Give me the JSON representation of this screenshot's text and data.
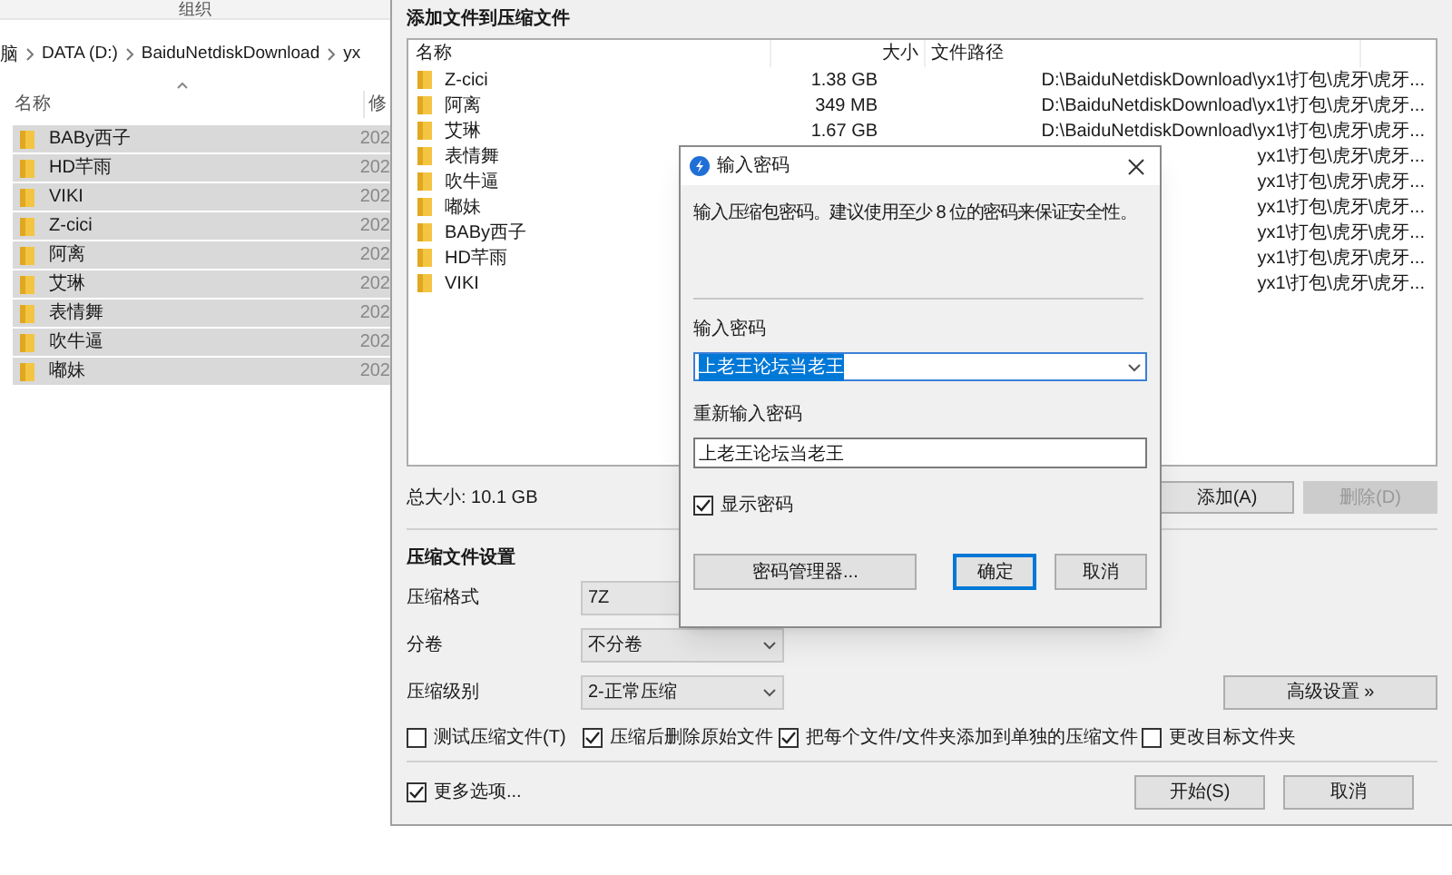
{
  "explorer": {
    "ribbon_label": "组织",
    "breadcrumb": [
      "脑",
      "DATA (D:)",
      "BaiduNetdiskDownload",
      "yx"
    ],
    "columns": [
      "名称",
      "修"
    ],
    "rows": [
      {
        "name": "BABy西子",
        "date": "202",
        "selected": true
      },
      {
        "name": "HD芊雨",
        "date": "202",
        "selected": true
      },
      {
        "name": "VIKI",
        "date": "202",
        "selected": true
      },
      {
        "name": "Z-cici",
        "date": "202",
        "selected": true
      },
      {
        "name": "阿离",
        "date": "202",
        "selected": true
      },
      {
        "name": "艾琳",
        "date": "202",
        "selected": true
      },
      {
        "name": "表情舞",
        "date": "202",
        "selected": true
      },
      {
        "name": "吹牛逼",
        "date": "202",
        "selected": true
      },
      {
        "name": "嘟妹",
        "date": "202",
        "selected": true
      }
    ]
  },
  "archive": {
    "title": "添加文件到压缩文件",
    "columns": [
      "名称",
      "大小",
      "文件路径"
    ],
    "files": [
      {
        "name": "Z-cici",
        "size": "1.38 GB",
        "path": "D:\\BaiduNetdiskDownload\\yx1\\打包\\虎牙\\虎牙..."
      },
      {
        "name": "阿离",
        "size": "349 MB",
        "path": "D:\\BaiduNetdiskDownload\\yx1\\打包\\虎牙\\虎牙..."
      },
      {
        "name": "艾琳",
        "size": "1.67 GB",
        "path": "D:\\BaiduNetdiskDownload\\yx1\\打包\\虎牙\\虎牙..."
      },
      {
        "name": "表情舞",
        "path": "yx1\\打包\\虎牙\\虎牙..."
      },
      {
        "name": "吹牛逼",
        "path": "yx1\\打包\\虎牙\\虎牙..."
      },
      {
        "name": "嘟妹",
        "path": "yx1\\打包\\虎牙\\虎牙..."
      },
      {
        "name": "BABy西子",
        "path": "yx1\\打包\\虎牙\\虎牙..."
      },
      {
        "name": "HD芊雨",
        "path": "yx1\\打包\\虎牙\\虎牙..."
      },
      {
        "name": "VIKI",
        "path": "yx1\\打包\\虎牙\\虎牙..."
      }
    ],
    "total": "总大小: 10.1 GB",
    "list_buttons": [
      {
        "label": "添加(A)",
        "disabled": false
      },
      {
        "label": "删除(D)",
        "disabled": true
      }
    ],
    "settings_title": "压缩文件设置",
    "settings": [
      {
        "label": "压缩格式",
        "value": "7Z"
      },
      {
        "label": "分卷",
        "value": "不分卷"
      },
      {
        "label": "压缩级别",
        "value": "2-正常压缩"
      }
    ],
    "advanced_button": "高级设置 »",
    "options": [
      {
        "label": "测试压缩文件(T)",
        "checked": false
      },
      {
        "label": "压缩后删除原始文件",
        "checked": true
      },
      {
        "label": "把每个文件/文件夹添加到单独的压缩文件",
        "checked": true
      },
      {
        "label": "更改目标文件夹",
        "checked": false
      }
    ],
    "more_options": {
      "label": "更多选项...",
      "checked": true
    },
    "buttons": [
      "开始(S)",
      "取消"
    ]
  },
  "password_dialog": {
    "title": "输入密码",
    "hint": "输入压缩包密码。建议使用至少 8 位的密码来保证安全性。",
    "password_label": "输入密码",
    "password_value": "上老王论坛当老王",
    "confirm_label": "重新输入密码",
    "confirm_value": "上老王论坛当老王",
    "show_password": {
      "label": "显示密码",
      "checked": true
    },
    "buttons": [
      {
        "label": "密码管理器...",
        "default": false
      },
      {
        "label": "确定",
        "default": true
      },
      {
        "label": "取消",
        "default": false
      }
    ]
  }
}
